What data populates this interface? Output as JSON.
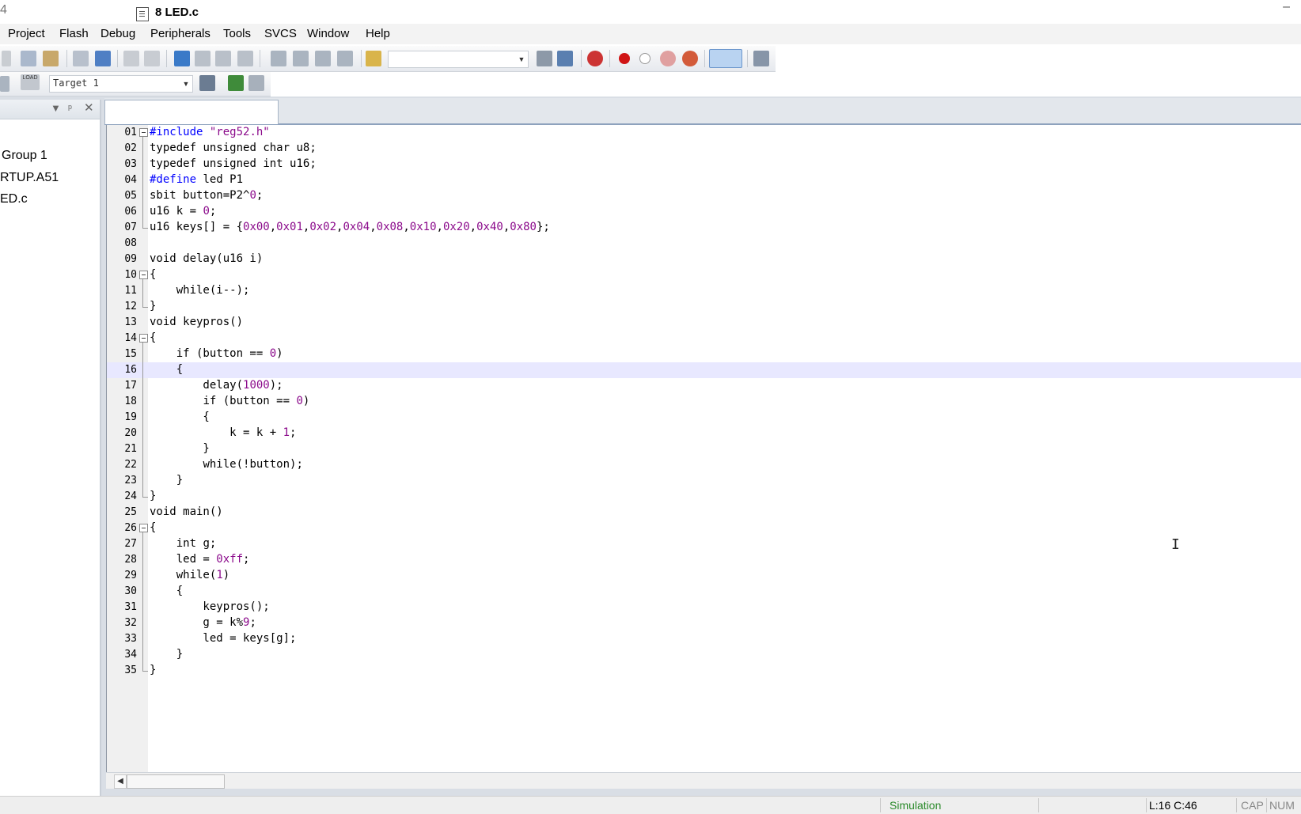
{
  "window": {
    "title_fragment": "4",
    "minimize_glyph": "–"
  },
  "menu": [
    "Project",
    "Flash",
    "Debug",
    "Peripherals",
    "Tools",
    "SVCS",
    "Window",
    "Help"
  ],
  "toolbar": {
    "target_select": "Target 1",
    "load_label": "LOAD"
  },
  "project_panel": {
    "items": [
      "Group 1",
      "RTUP.A51",
      "ED.c"
    ]
  },
  "editor": {
    "tab_label": "8 LED.c",
    "current_line": 16,
    "colors": {
      "keyword": "#000000",
      "number": "#8b0a8b",
      "string": "#8b0a8b",
      "preprocessor": "#0000ff",
      "current_line_bg": "#e8e8ff"
    },
    "lines": [
      "#include \"reg52.h\"",
      "typedef unsigned char u8;",
      "typedef unsigned int u16;",
      "#define led P1",
      "sbit button=P2^0;",
      "u16 k = 0;",
      "u16 keys[] = {0x00,0x01,0x02,0x04,0x08,0x10,0x20,0x40,0x80};",
      "",
      "void delay(u16 i)",
      "{",
      "    while(i--);",
      "}",
      "void keypros()",
      "{",
      "    if (button == 0)",
      "    {",
      "        delay(1000);",
      "        if (button == 0)",
      "        {",
      "            k = k + 1;",
      "        }",
      "        while(!button);",
      "    }",
      "}",
      "void main()",
      "{",
      "    int g;",
      "    led = 0xff;",
      "    while(1)",
      "    {",
      "        keypros();",
      "        g = k%9;",
      "        led = keys[g];",
      "    }",
      "}"
    ],
    "fold_markers": {
      "1": "box",
      "2": "line",
      "3": "line",
      "4": "line",
      "5": "line",
      "6": "line",
      "7": "corner",
      "10": "box",
      "11": "line",
      "12": "corner",
      "14": "box",
      "15": "line",
      "16": "line",
      "17": "line",
      "18": "line",
      "19": "line",
      "20": "line",
      "21": "line",
      "22": "line",
      "23": "line",
      "24": "corner",
      "26": "box",
      "27": "line",
      "28": "line",
      "29": "line",
      "30": "line",
      "31": "line",
      "32": "line",
      "33": "line",
      "34": "line",
      "35": "corner"
    }
  },
  "status": {
    "mode": "Simulation",
    "position": "L:16 C:46",
    "caps": "CAP",
    "num": "NUM"
  }
}
